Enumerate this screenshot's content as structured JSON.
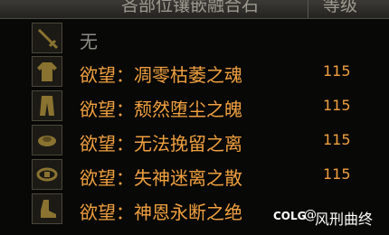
{
  "header": {
    "name_column": "吝部位镶嵌融合石",
    "level_column": "等级"
  },
  "rows": [
    {
      "slot_icon": "weapon-slot-icon",
      "name": "无",
      "level": ""
    },
    {
      "slot_icon": "top-armor-slot-icon",
      "name": "欲望：凋零枯萎之魂",
      "level": "115"
    },
    {
      "slot_icon": "bottom-armor-slot-icon",
      "name": "欲望：颓然堕尘之魄",
      "level": "115"
    },
    {
      "slot_icon": "shoulder-slot-icon",
      "name": "欲望：无法挽留之离",
      "level": "115"
    },
    {
      "slot_icon": "belt-slot-icon",
      "name": "欲望：失神迷离之散",
      "level": "115"
    },
    {
      "slot_icon": "shoes-slot-icon",
      "name": "欲望：神恩永断之绝",
      "level": ""
    }
  ],
  "watermark": {
    "logo": "COLG",
    "separator": "@",
    "author": "风刑曲终"
  },
  "colors": {
    "item_name": "#f0a040",
    "empty_name": "#8e8c85",
    "background": "#080806"
  }
}
